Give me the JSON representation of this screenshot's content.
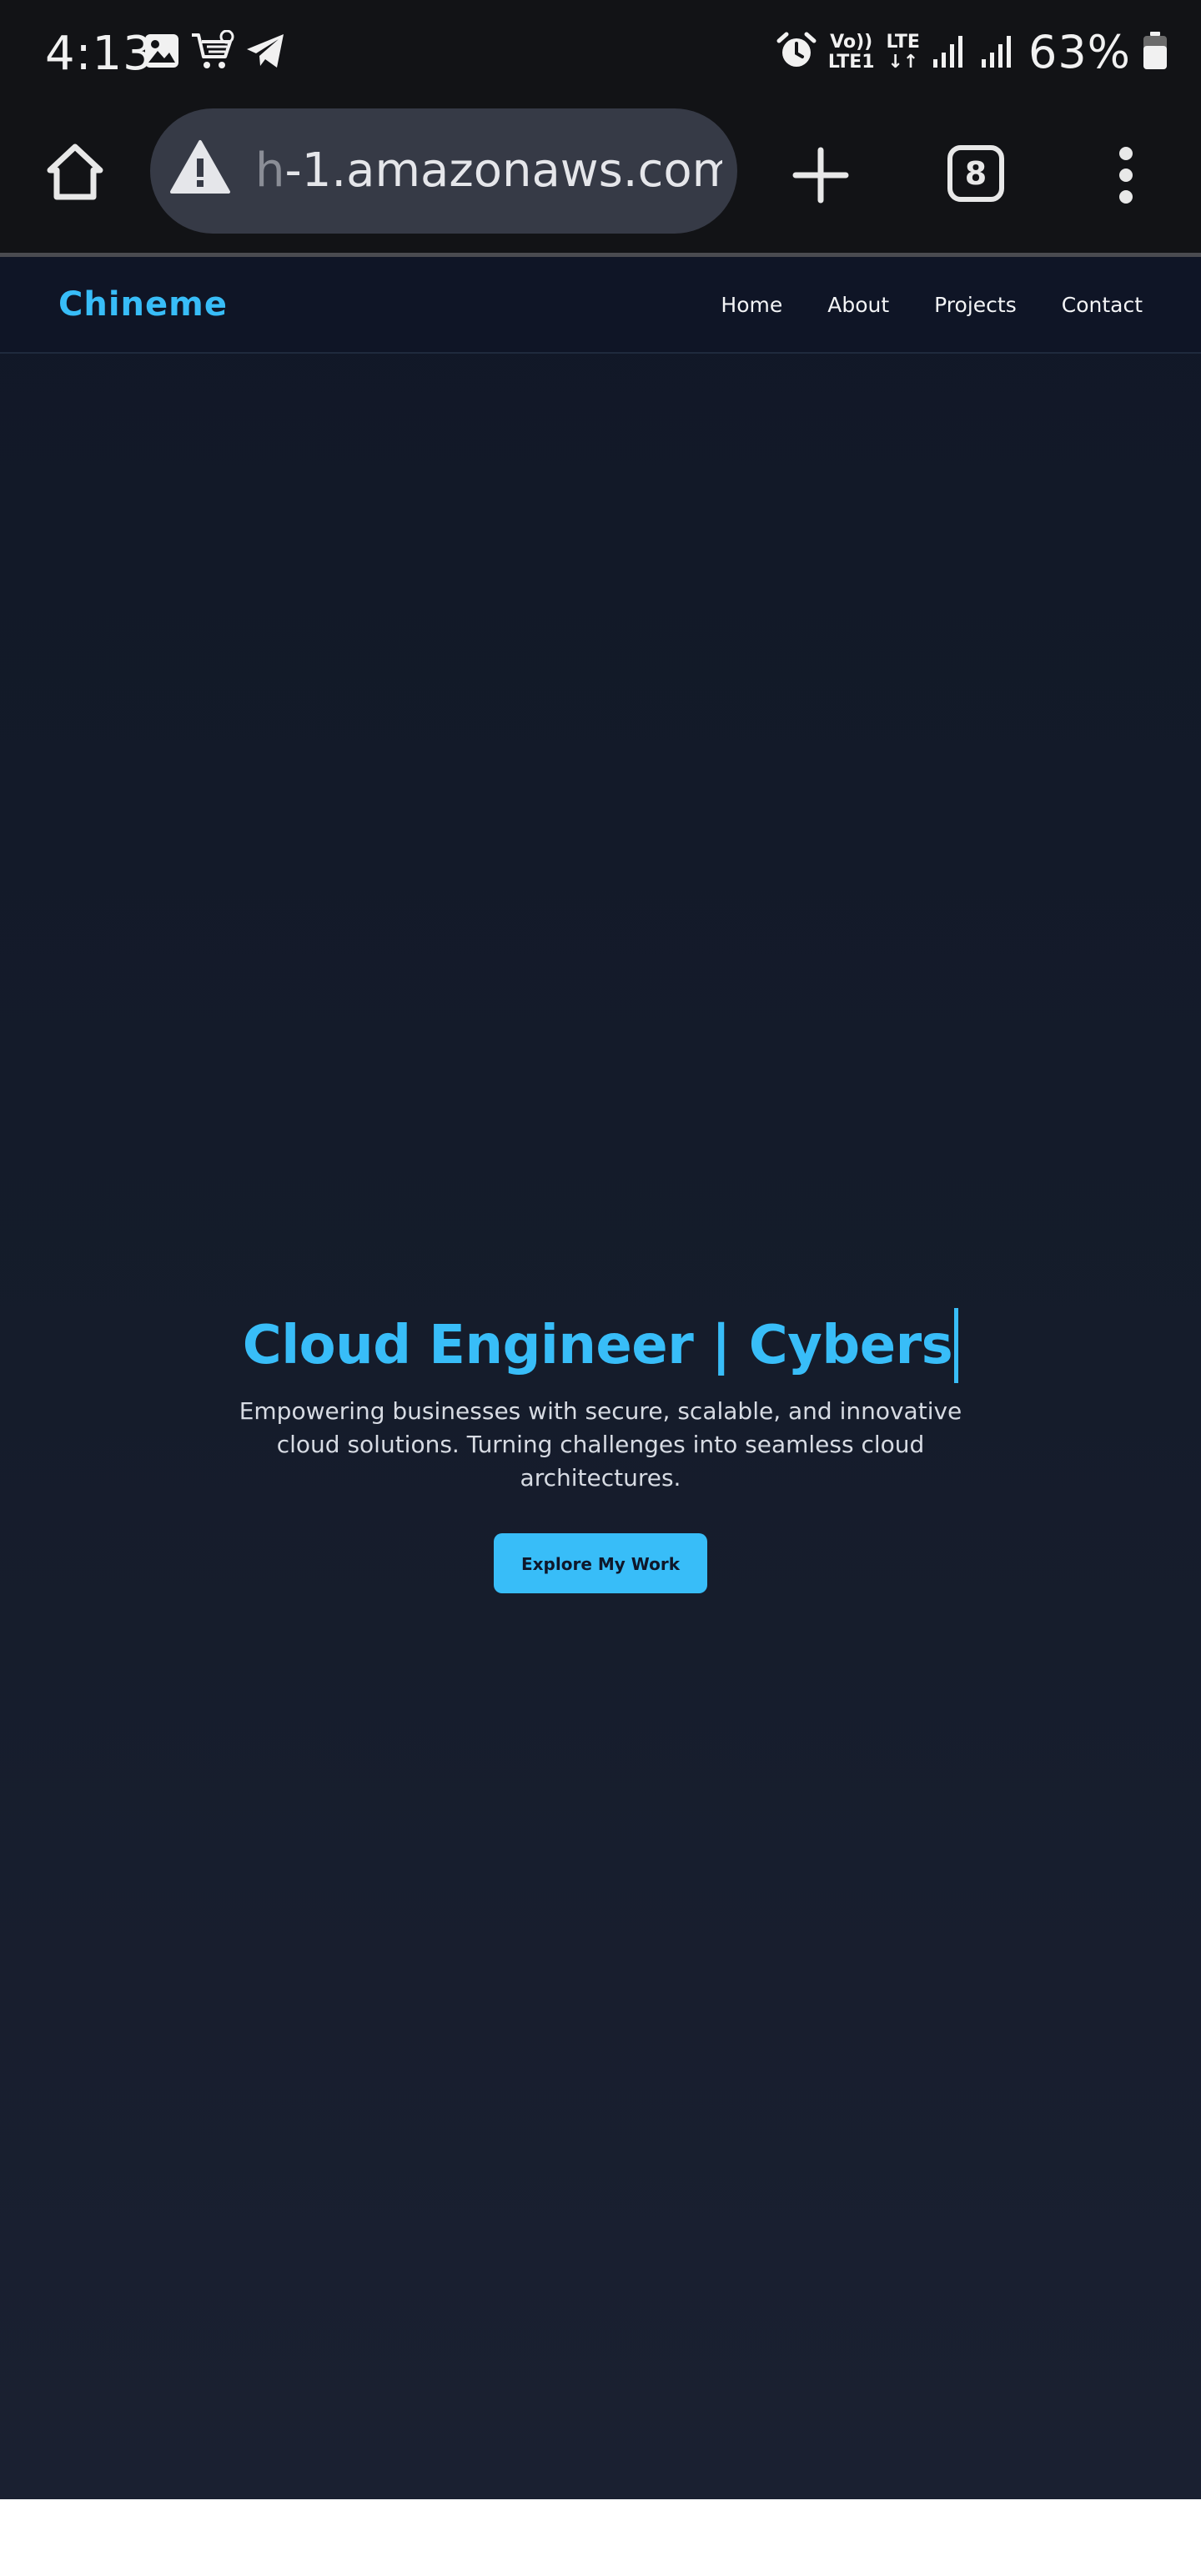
{
  "status_bar": {
    "time": "4:13",
    "network_top": "Vo))",
    "network_bottom": "LTE1",
    "lte_top": "LTE",
    "lte_bottom": "↓↑",
    "battery_percent": "63%",
    "left_icons": [
      "gallery-icon",
      "shopping-cart-icon",
      "telegram-icon"
    ],
    "right_icons": [
      "alarm-icon",
      "signal-icon",
      "signal-icon",
      "battery-icon"
    ]
  },
  "browser": {
    "url_faded": "h",
    "url_main": "-1.amazonaws.com",
    "tab_count": "8",
    "icons": [
      "home-icon",
      "warning-icon",
      "plus-icon",
      "tab-switcher-icon",
      "more-vert-icon"
    ]
  },
  "site": {
    "logo": "Chineme",
    "nav": {
      "home": "Home",
      "about": "About",
      "projects": "Projects",
      "contact": "Contact"
    },
    "hero": {
      "title": "Cloud Engineer | Cybers",
      "subtitle": "Empowering businesses with secure, scalable, and innovative cloud solutions. Turning challenges into seamless cloud architectures.",
      "button": "Explore My Work"
    },
    "colors": {
      "accent": "#38bdf8",
      "background": "#111827",
      "nav_background": "#0f1526"
    }
  }
}
